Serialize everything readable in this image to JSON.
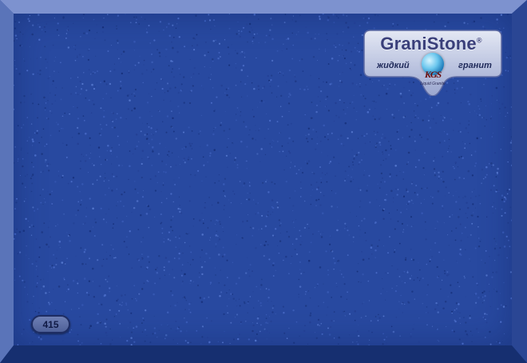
{
  "brand": {
    "name": "GraniStone",
    "registered_mark": "®",
    "tagline_left": "жидкий",
    "tagline_right": "гранит",
    "monogram": "KGS",
    "sub_line": "Liquid Granite"
  },
  "sample": {
    "code": "415"
  },
  "colors": {
    "surface": "#2849a0",
    "bevel_top": "#7d92cf",
    "bevel_left": "#5a74b9",
    "bevel_right": "#2a4694",
    "bevel_bottom": "#162f70",
    "badge": "#5e70a8"
  }
}
